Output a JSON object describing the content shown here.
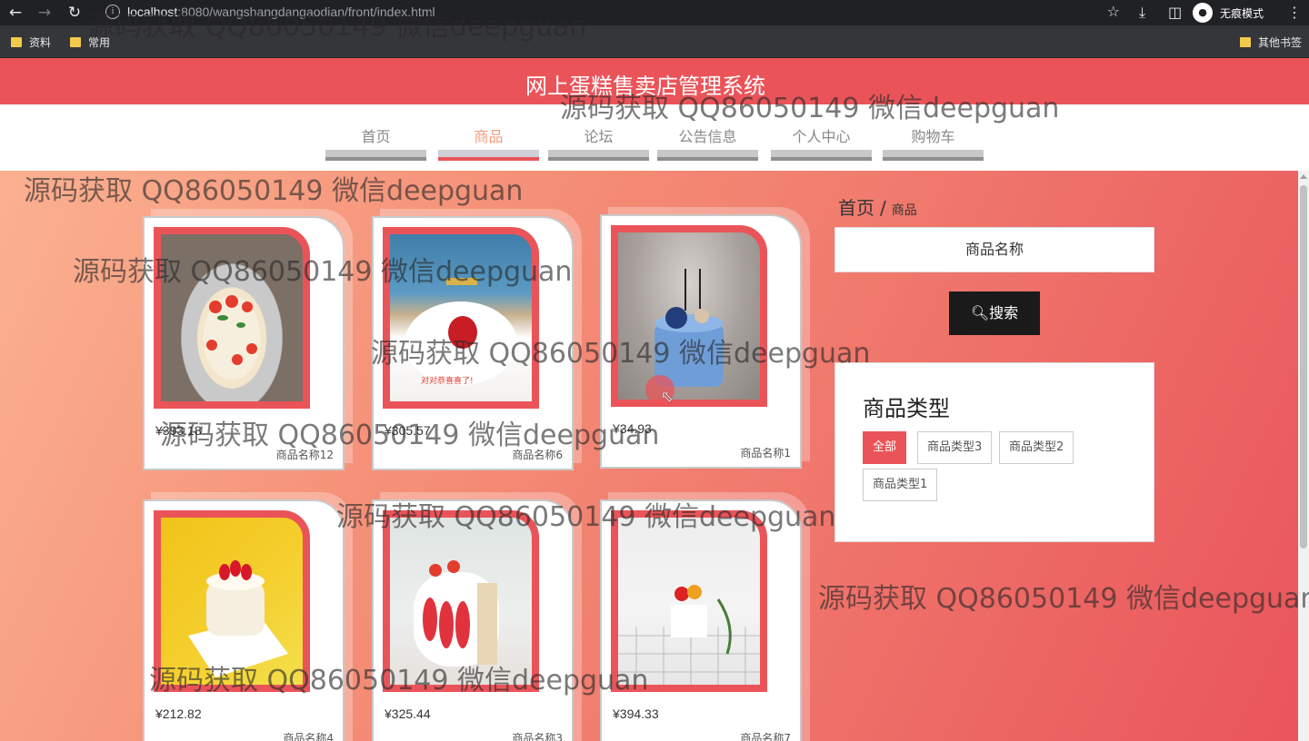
{
  "browser": {
    "url_host": "localhost",
    "url_rest": ":8080/wangshangdangaodian/front/index.html",
    "incognito_label": "无痕模式",
    "bookmarks": [
      "资料",
      "常用"
    ],
    "other_bookmarks": "其他书签"
  },
  "site": {
    "title": "网上蛋糕售卖店管理系统"
  },
  "nav": {
    "items": [
      "首页",
      "商品",
      "论坛",
      "公告信息",
      "个人中心",
      "购物车"
    ],
    "active_index": 1
  },
  "breadcrumb": {
    "home": "首页",
    "separator": "/",
    "current": "商品"
  },
  "search": {
    "placeholder": "商品名称",
    "button_label": "搜索"
  },
  "categories": {
    "title": "商品类型",
    "tags": [
      "全部",
      "商品类型3",
      "商品类型2",
      "商品类型1"
    ],
    "active": "全部"
  },
  "products": [
    {
      "price": "¥393.18",
      "name": "商品名称12"
    },
    {
      "price": "¥305.57",
      "name": "商品名称6"
    },
    {
      "price": "¥34.93",
      "name": "商品名称1"
    },
    {
      "price": "¥212.82",
      "name": "商品名称4"
    },
    {
      "price": "¥325.44",
      "name": "商品名称3"
    },
    {
      "price": "¥394.33",
      "name": "商品名称7"
    }
  ],
  "watermark": "源码获取 QQ86050149 微信deepguan",
  "colors": {
    "brand": "#ea5459",
    "nav_active_text": "#f49a7c",
    "search_button": "#1a1a1a"
  }
}
